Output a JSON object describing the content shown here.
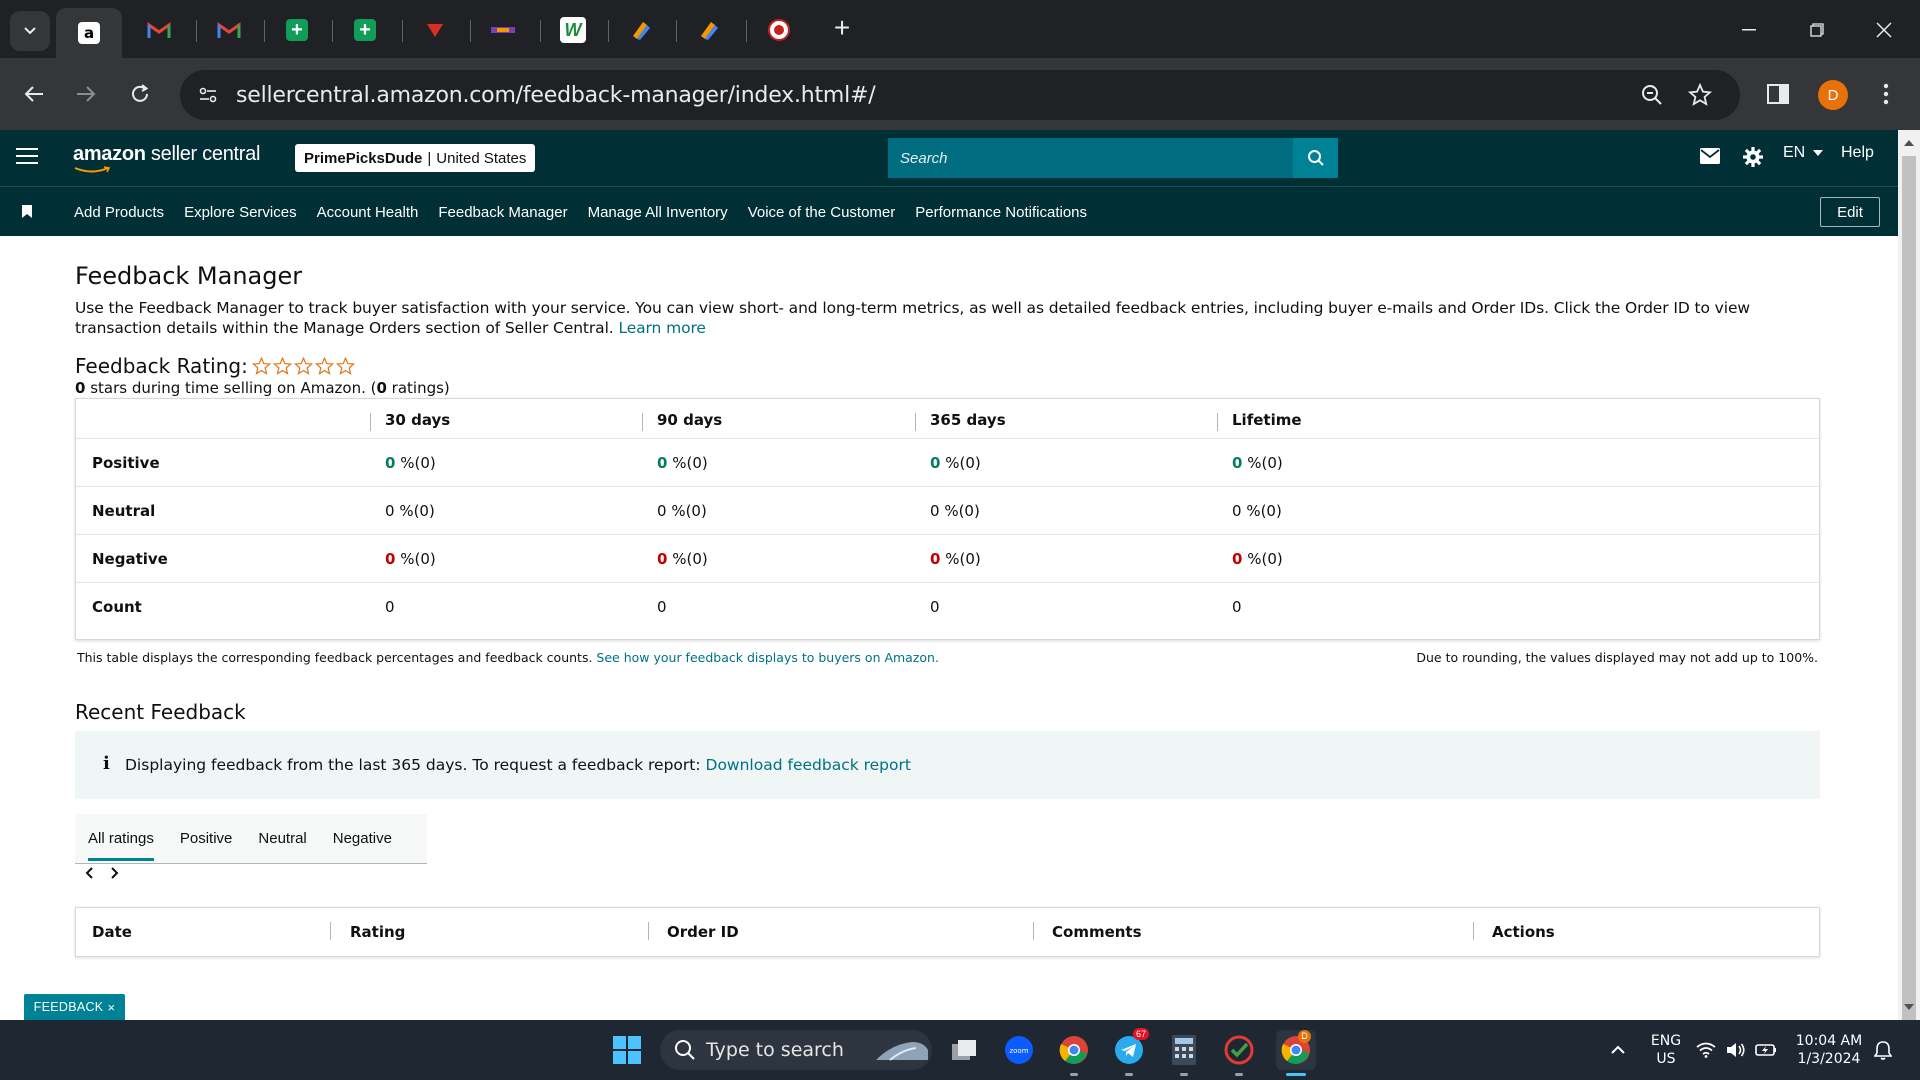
{
  "browser": {
    "url": "sellercentral.amazon.com/feedback-manager/index.html#/",
    "profile_initial": "D",
    "tabs": [
      {
        "icon": "amazon-icon",
        "active": true
      },
      {
        "icon": "gmail-icon"
      },
      {
        "icon": "gmail-icon"
      },
      {
        "icon": "sheets-icon"
      },
      {
        "icon": "sheets-icon"
      },
      {
        "icon": "site-icon"
      },
      {
        "icon": "site-icon"
      },
      {
        "icon": "w-app-icon"
      },
      {
        "icon": "tool-icon"
      },
      {
        "icon": "tool-icon"
      },
      {
        "icon": "site-icon"
      }
    ]
  },
  "header": {
    "logo_bold": "amazon",
    "logo_rest": " seller central",
    "store_name": "PrimePicksDude",
    "store_region": "United States",
    "search_placeholder": "Search",
    "language": "EN",
    "help": "Help"
  },
  "nav": {
    "items": [
      "Add Products",
      "Explore Services",
      "Account Health",
      "Feedback Manager",
      "Manage All Inventory",
      "Voice of the Customer",
      "Performance Notifications"
    ],
    "edit": "Edit"
  },
  "page": {
    "title": "Feedback Manager",
    "intro": "Use the Feedback Manager to track buyer satisfaction with your service. You can view short- and long-term metrics, as well as detailed feedback entries, including buyer e-mails and Order IDs. Click the Order ID to view transaction details within the Manage Orders section of Seller Central.",
    "learn_more": "Learn more",
    "rating_label": "Feedback Rating:",
    "stars_count": "0",
    "stars_text": " stars during time selling on Amazon. (",
    "ratings_count": "0",
    "ratings_text": " ratings)"
  },
  "feedback_table": {
    "columns": [
      "30 days",
      "90 days",
      "365 days",
      "Lifetime"
    ],
    "rows": [
      {
        "label": "Positive",
        "values": [
          "0",
          "0",
          "0",
          "0"
        ],
        "suffix": "%(0)",
        "tone": "green"
      },
      {
        "label": "Neutral",
        "values": [
          "0",
          "0",
          "0",
          "0"
        ],
        "suffix": "%(0)",
        "tone": "plain"
      },
      {
        "label": "Negative",
        "values": [
          "0",
          "0",
          "0",
          "0"
        ],
        "suffix": "%(0)",
        "tone": "red"
      },
      {
        "label": "Count",
        "values": [
          "0",
          "0",
          "0",
          "0"
        ],
        "suffix": "",
        "tone": "count"
      }
    ],
    "note_left": "This table displays the corresponding feedback percentages and feedback counts.",
    "note_link": "See how your feedback displays to buyers on Amazon.",
    "note_right": "Due to rounding, the values displayed may not add up to 100%."
  },
  "recent": {
    "title": "Recent Feedback",
    "info_text": "Displaying feedback from the last 365 days. To request a feedback report:",
    "info_link": "Download feedback report",
    "tabs": [
      "All ratings",
      "Positive",
      "Neutral",
      "Negative"
    ],
    "columns": [
      "Date",
      "Rating",
      "Order ID",
      "Comments",
      "Actions"
    ]
  },
  "feedback_tab": "FEEDBACK",
  "taskbar": {
    "search_placeholder": "Type to search",
    "lang_line1": "ENG",
    "lang_line2": "US",
    "time": "10:04 AM",
    "date": "1/3/2024",
    "telegram_badge": "67",
    "chrome_badge": "D"
  },
  "colors": {
    "header_bg": "#002f36",
    "accent": "#008296",
    "positive": "#067d62",
    "negative": "#c40000",
    "link": "#007185"
  }
}
